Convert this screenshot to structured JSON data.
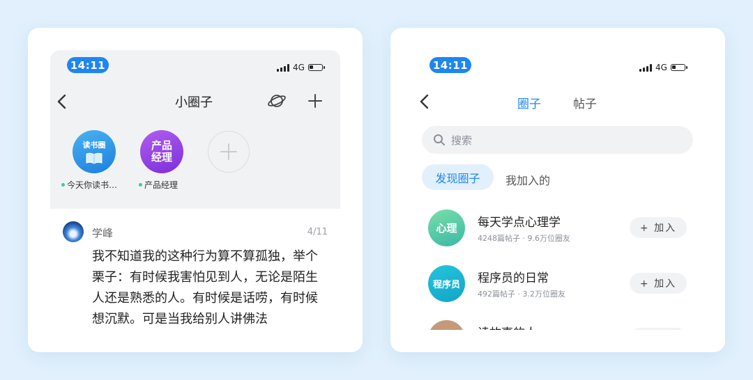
{
  "left_screen": {
    "status_time": "14:11",
    "network": "4G",
    "title": "小圈子",
    "header_icons": [
      "back-arrow",
      "planet-icon",
      "plus-icon"
    ],
    "circles": [
      {
        "icon_text": "读书圈",
        "label": "今天你读书…",
        "color": "#2f9be8"
      },
      {
        "icon_text": "产品经理",
        "label": "产品经理",
        "color": "#8a3fe0"
      }
    ],
    "add_circle": "plus",
    "post": {
      "author": "学峰",
      "date": "4/11",
      "text": "我不知道我的这种行为算不算孤独，举个栗子：有时候我害怕见到人，无论是陌生人还是熟悉的人。有时候是话唠，有时候想沉默。可是当我给别人讲佛法"
    }
  },
  "right_screen": {
    "status_time": "14:11",
    "network": "4G",
    "tabs": [
      {
        "label": "圈子",
        "active": true
      },
      {
        "label": "帖子",
        "active": false
      }
    ],
    "search": {
      "placeholder": "搜索"
    },
    "segments": [
      {
        "label": "发现圈子",
        "active": true
      },
      {
        "label": "我加入的",
        "active": false
      }
    ],
    "groups": [
      {
        "icon_text": "心理",
        "name": "每天学点心理学",
        "stats": "4248篇帖子 · 9.6万位圈友",
        "join": "+ 加入"
      },
      {
        "icon_text": "程序员",
        "name": "程序员的日常",
        "stats": "492篇帖子 · 3.2万位圈友",
        "join": "+ 加入"
      },
      {
        "icon_text": "",
        "name": "读故事的人",
        "stats": "",
        "join": ""
      }
    ]
  }
}
